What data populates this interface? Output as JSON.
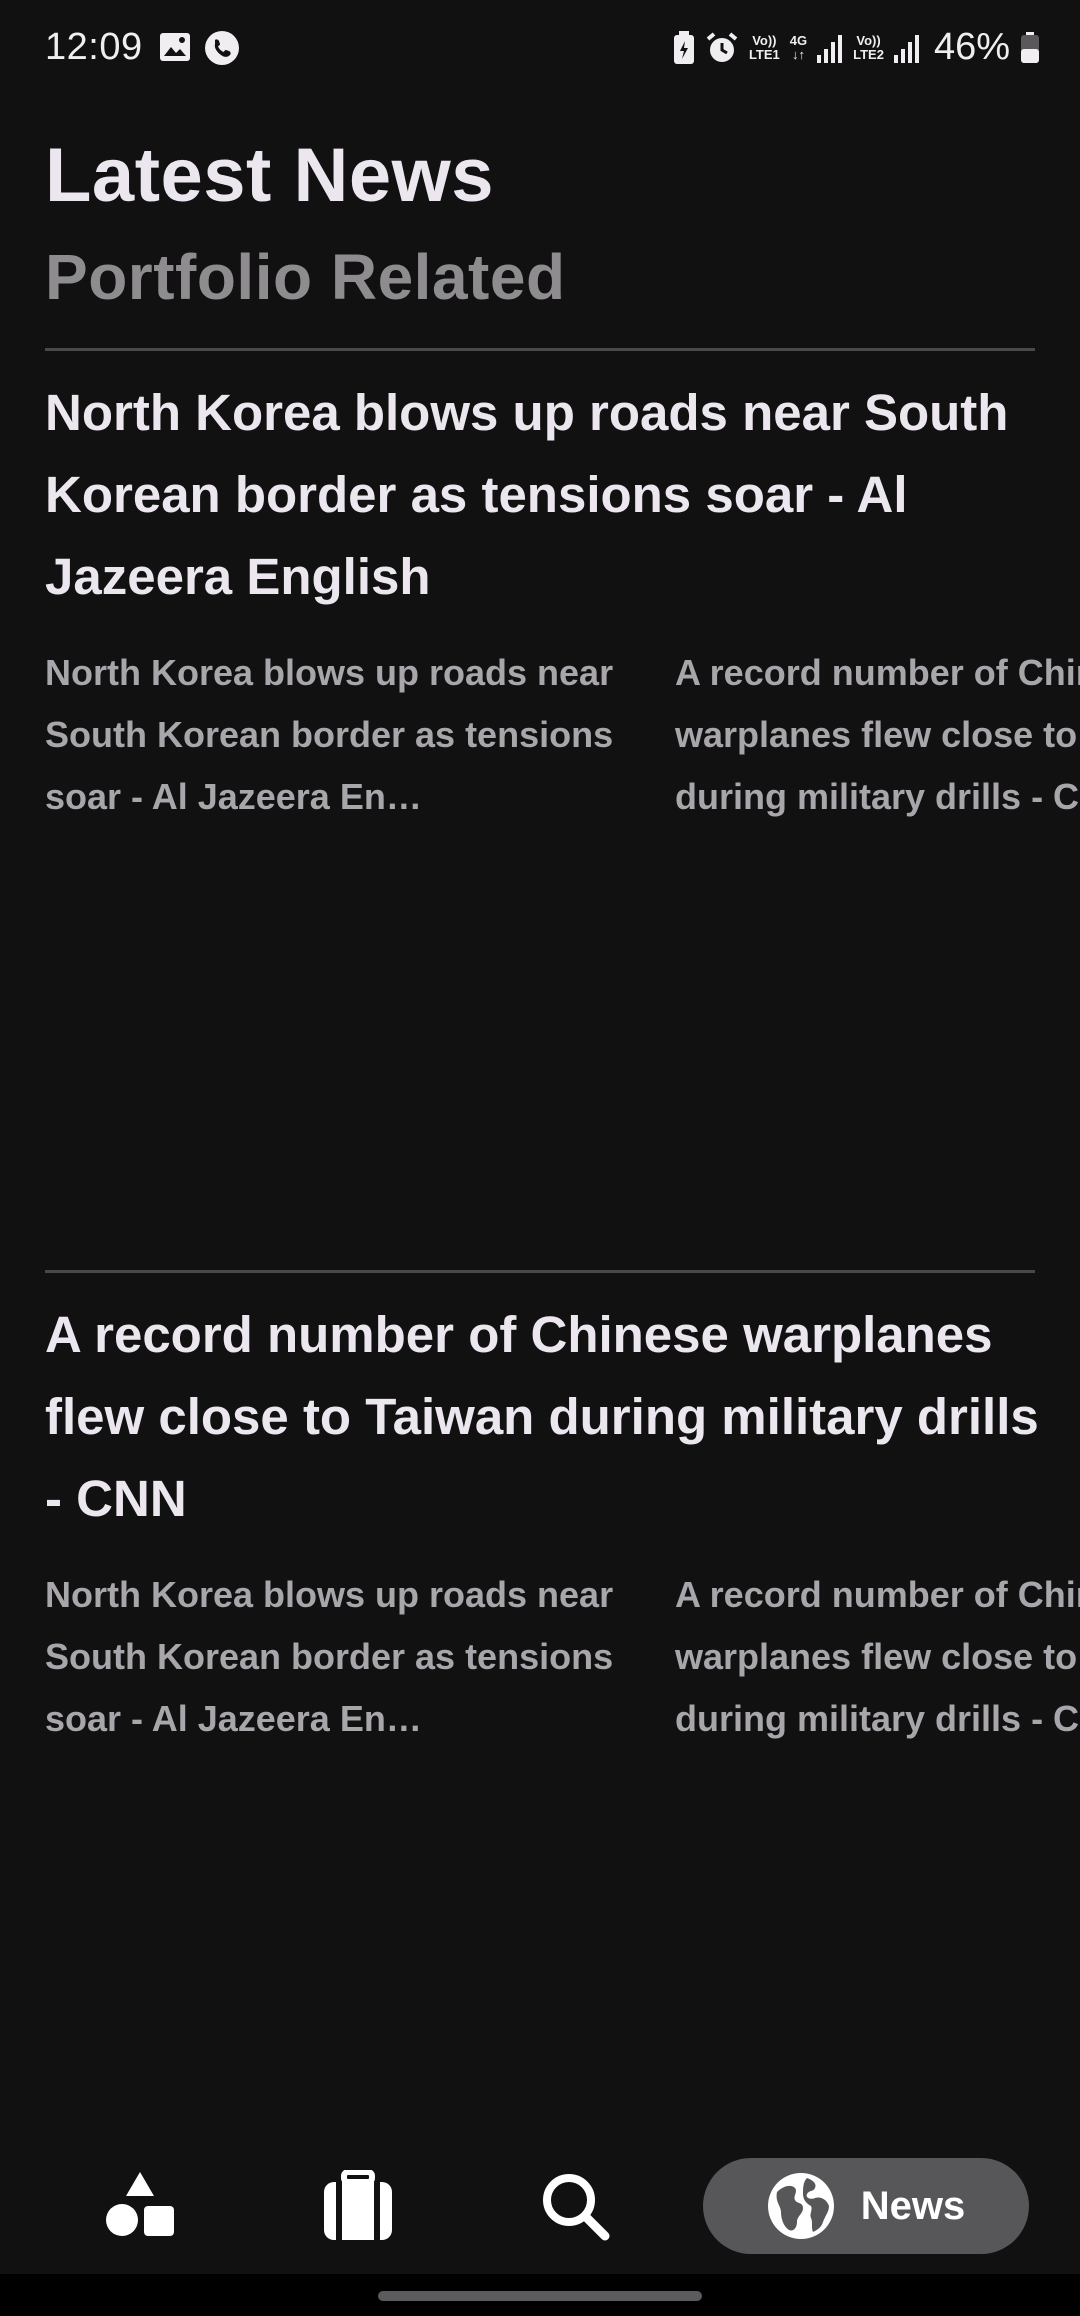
{
  "status_bar": {
    "time": "12:09",
    "battery_percent": "46%",
    "net_lte1_top": "Vo))",
    "net_lte1_bottom": "LTE1",
    "net_4g": "4G",
    "net_lte2_top": "Vo))",
    "net_lte2_bottom": "LTE2"
  },
  "header": {
    "title": "Latest News",
    "subtitle": "Portfolio Related"
  },
  "articles": [
    {
      "headline": "North Korea blows up roads near South Korean border as tensions soar - Al Jazeera English",
      "related": [
        "North Korea blows up roads near South Korean border as tensions soar - Al Jazeera En…",
        "A record number of Chinese warplanes flew close to Taiwan during military drills - CNN"
      ]
    },
    {
      "headline": "A record number of Chinese warplanes flew close to Taiwan during military drills - CNN",
      "related": [
        "North Korea blows up roads near South Korean border as tensions soar - Al Jazeera En…",
        "A record number of Chinese warplanes flew close to Taiwan during military drills - CNN"
      ]
    }
  ],
  "nav": {
    "items": [
      {
        "icon": "shapes-icon"
      },
      {
        "icon": "briefcase-icon"
      },
      {
        "icon": "search-icon"
      },
      {
        "icon": "globe-icon",
        "label": "News",
        "active": true
      }
    ]
  }
}
